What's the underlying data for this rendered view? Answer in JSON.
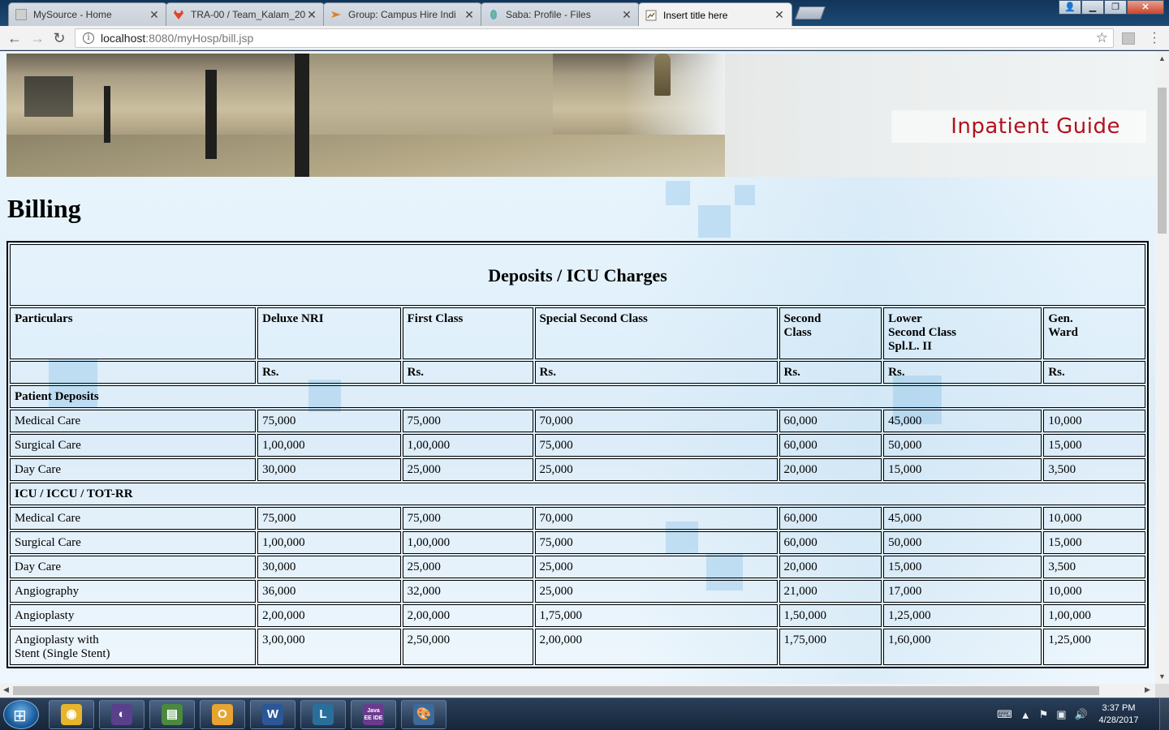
{
  "browser": {
    "tabs": [
      {
        "title": "MySource - Home",
        "active": false,
        "favicon_color": "#cccccc"
      },
      {
        "title": "TRA-00 / Team_Kalam_20",
        "active": false,
        "favicon_color": "#e24329"
      },
      {
        "title": "Group: Campus Hire Indi",
        "active": false,
        "favicon_color": "#d9822b"
      },
      {
        "title": "Saba: Profile - Files",
        "active": false,
        "favicon_color": "#5aa7c9"
      },
      {
        "title": "Insert title here",
        "active": true,
        "favicon_color": "#888888"
      }
    ],
    "url_host": "localhost",
    "url_path": ":8080/myHosp/bill.jsp"
  },
  "banner": {
    "label": "Inpatient Guide"
  },
  "page": {
    "title": "Billing"
  },
  "table": {
    "caption": "Deposits / ICU Charges",
    "headers": [
      "Particulars",
      "Deluxe NRI",
      "First Class",
      "Special Second Class",
      "Second\nClass",
      "Lower\nSecond Class\nSpl.L. II",
      "Gen.\nWard"
    ],
    "currency_row": [
      "",
      "Rs.",
      "Rs.",
      "Rs.",
      "Rs.",
      "Rs.",
      "Rs."
    ],
    "sections": [
      {
        "title": "Patient Deposits",
        "rows": [
          [
            "Medical Care",
            "75,000",
            "75,000",
            "70,000",
            "60,000",
            "45,000",
            "10,000"
          ],
          [
            "Surgical Care",
            "1,00,000",
            "1,00,000",
            "75,000",
            "60,000",
            "50,000",
            "15,000"
          ],
          [
            "Day Care",
            "30,000",
            "25,000",
            "25,000",
            "20,000",
            "15,000",
            "3,500"
          ]
        ]
      },
      {
        "title": "ICU / ICCU / TOT-RR",
        "rows": [
          [
            "Medical Care",
            "75,000",
            "75,000",
            "70,000",
            "60,000",
            "45,000",
            "10,000"
          ],
          [
            "Surgical Care",
            "1,00,000",
            "1,00,000",
            "75,000",
            "60,000",
            "50,000",
            "15,000"
          ],
          [
            "Day Care",
            "30,000",
            "25,000",
            "25,000",
            "20,000",
            "15,000",
            "3,500"
          ],
          [
            "Angiography",
            "36,000",
            "32,000",
            "25,000",
            "21,000",
            "17,000",
            "10,000"
          ],
          [
            "Angioplasty",
            "2,00,000",
            "2,00,000",
            "1,75,000",
            "1,50,000",
            "1,25,000",
            "1,00,000"
          ],
          [
            "Angioplasty with\nStent (Single Stent)",
            "3,00,000",
            "2,50,000",
            "2,00,000",
            "1,75,000",
            "1,60,000",
            "1,25,000"
          ]
        ]
      }
    ]
  },
  "taskbar": {
    "apps": [
      {
        "name": "chrome-icon",
        "glyph": "◉",
        "color": "#e8b52a"
      },
      {
        "name": "eclipse-icon",
        "glyph": "◐",
        "color": "#5a3f8c"
      },
      {
        "name": "database-tool-icon",
        "glyph": "▤",
        "color": "#4a8a3c"
      },
      {
        "name": "outlook-icon",
        "glyph": "O",
        "color": "#e8a431"
      },
      {
        "name": "word-icon",
        "glyph": "W",
        "color": "#2b5797"
      },
      {
        "name": "lync-icon",
        "glyph": "L",
        "color": "#2a6f9c"
      },
      {
        "name": "java-ee-ide-icon",
        "glyph": "Java EE IDE",
        "color": "#6b3a8f"
      },
      {
        "name": "paint-icon",
        "glyph": "🎨",
        "color": "#3c6a9a"
      }
    ],
    "time": "3:37 PM",
    "date": "4/28/2017"
  }
}
